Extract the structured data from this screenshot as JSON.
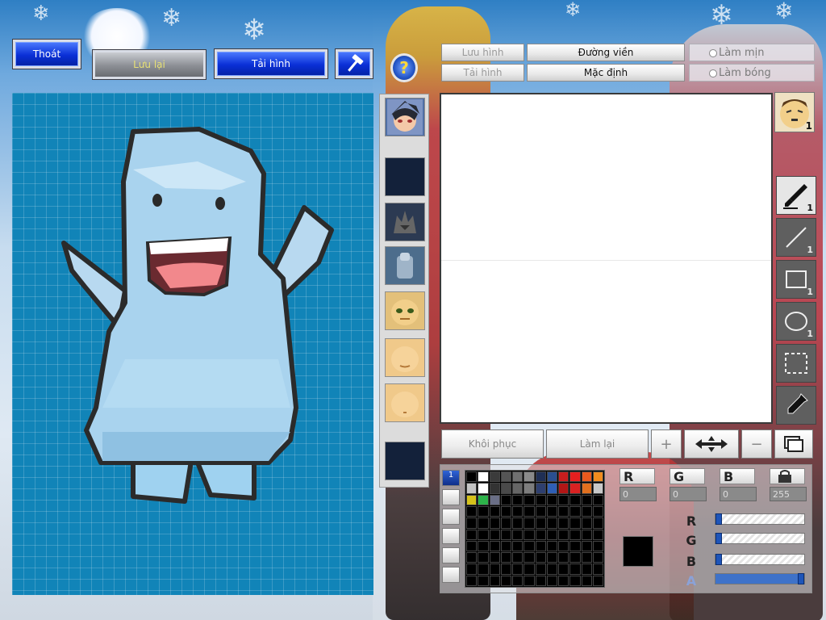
{
  "toolbar": {
    "exit_label": "Thoát",
    "save_label": "Lưu lại",
    "reload_label": "Tải hình",
    "help_label": "?"
  },
  "options": {
    "save_image_label": "Lưu hình",
    "load_image_label": "Tải hình",
    "outline_label": "Đường viền",
    "default_label": "Mặc định",
    "smooth_label": "Làm mịn",
    "shade_label": "Làm bóng"
  },
  "tools": [
    {
      "name": "brush-tool",
      "icon": "brush-icon",
      "count": "1"
    },
    {
      "name": "line-tool",
      "icon": "line-icon",
      "count": "1"
    },
    {
      "name": "rectangle-tool",
      "icon": "rectangle-icon",
      "count": "1"
    },
    {
      "name": "ellipse-tool",
      "icon": "ellipse-icon",
      "count": "1"
    },
    {
      "name": "select-tool",
      "icon": "selection-icon",
      "count": ""
    },
    {
      "name": "eyedropper-tool",
      "icon": "eyedropper-icon",
      "count": ""
    }
  ],
  "avatar_badge": "1",
  "actions": {
    "undo_label": "Khôi phục",
    "redo_label": "Làm lại",
    "zoom_in_label": "+",
    "zoom_out_label": "−"
  },
  "color": {
    "r_label": "R",
    "g_label": "G",
    "b_label": "B",
    "a_label": "A",
    "r_value": "0",
    "g_value": "0",
    "b_value": "0",
    "a_value": "255",
    "current_hex": "#000000",
    "r_level": 0,
    "g_level": 0,
    "b_level": 0,
    "a_level": 1
  },
  "palette_tab_label": "1",
  "palette_row1": [
    "#000000",
    "#ffffff",
    "#3b3b3b",
    "#555555",
    "#707070",
    "#8a8a8a",
    "#1f2f55",
    "#2a4f8f",
    "#c81e1e",
    "#e61f1f",
    "#e85a1e",
    "#f08c1e"
  ],
  "palette_row2": [
    "#c4c4c4",
    "#ffffff",
    "#333333",
    "#4a4a4a",
    "#666666",
    "#7d7d7d",
    "#2e3f6f",
    "#2f5fb5",
    "#b21616",
    "#d92222",
    "#e0701f",
    "#c8c8c8"
  ],
  "palette_row3": [
    "#d6c21a",
    "#2db34a",
    "#6a6f86"
  ]
}
